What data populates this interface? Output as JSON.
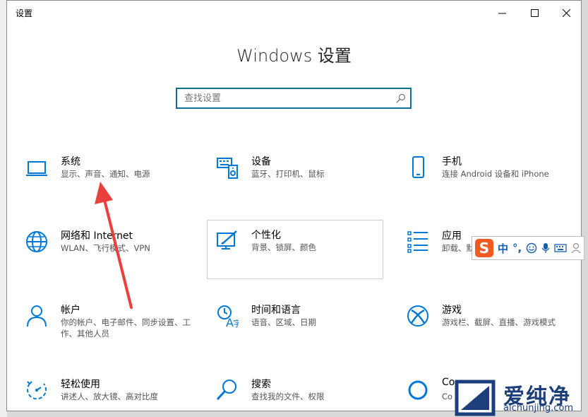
{
  "window": {
    "title": "设置",
    "heading": "Windows 设置"
  },
  "search": {
    "placeholder": "查找设置"
  },
  "tiles": [
    {
      "title": "系统",
      "desc": "显示、声音、通知、电源",
      "icon": "laptop-icon"
    },
    {
      "title": "设备",
      "desc": "蓝牙、打印机、鼠标",
      "icon": "keyboard-devices-icon"
    },
    {
      "title": "手机",
      "desc": "连接 Android 设备和 iPhone",
      "icon": "phone-icon"
    },
    {
      "title": "网络和 Internet",
      "desc": "WLAN、飞行模式、VPN",
      "icon": "globe-icon"
    },
    {
      "title": "个性化",
      "desc": "背景、锁屏、颜色",
      "icon": "paint-icon"
    },
    {
      "title": "应用",
      "desc": "卸载、默认应用、可选功能",
      "icon": "apps-list-icon"
    },
    {
      "title": "帐户",
      "desc": "你的帐户、电子邮件、同步设置、工作、其他人员",
      "icon": "person-icon"
    },
    {
      "title": "时间和语言",
      "desc": "语音、区域、日期",
      "icon": "time-language-icon"
    },
    {
      "title": "游戏",
      "desc": "游戏栏、截屏、直播、游戏模式",
      "icon": "xbox-icon"
    },
    {
      "title": "轻松使用",
      "desc": "讲述人、放大镜、高对比度",
      "icon": "ease-of-access-icon"
    },
    {
      "title": "搜索",
      "desc": "查找我的文件、权限",
      "icon": "search-magnifier-icon"
    },
    {
      "title": "Co",
      "desc": "Co",
      "icon": "cortana-icon"
    }
  ],
  "ime": {
    "logo": "S",
    "mode": "中",
    "punct": "°,"
  },
  "watermark": {
    "title": "爱纯净",
    "url": "aichunjing.com"
  },
  "colors": {
    "accent": "#0078d7",
    "arrow": "#e8403a"
  }
}
